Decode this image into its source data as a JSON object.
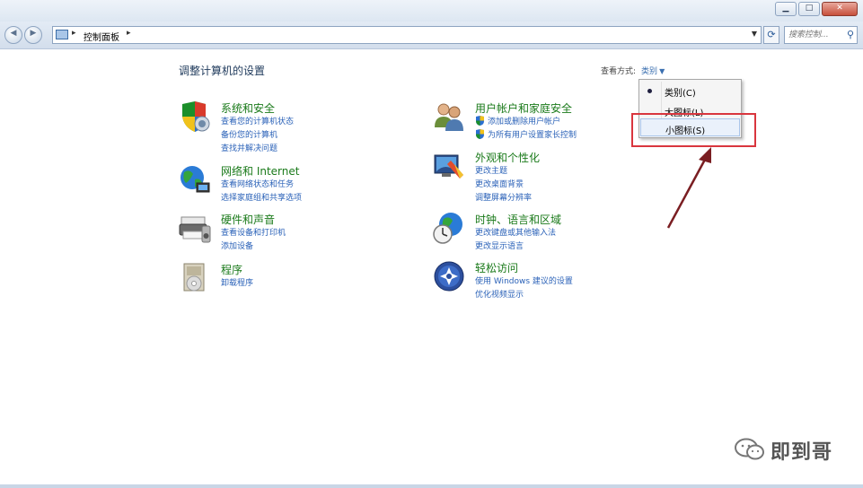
{
  "window": {
    "caption_buttons": [
      "minimize",
      "maximize",
      "close"
    ]
  },
  "navbar": {
    "address": "控制面板",
    "search_placeholder": "搜索控制..."
  },
  "content": {
    "title": "调整计算机的设置",
    "view_by_label": "查看方式:",
    "view_by_value": "类别"
  },
  "categories": [
    {
      "icon": "system-security-icon",
      "title": "系统和安全",
      "links": [
        "查看您的计算机状态",
        "备份您的计算机",
        "查找并解决问题"
      ]
    },
    {
      "icon": "network-internet-icon",
      "title": "网络和 Internet",
      "links": [
        "查看网络状态和任务",
        "选择家庭组和共享选项"
      ]
    },
    {
      "icon": "hardware-sound-icon",
      "title": "硬件和声音",
      "links": [
        "查看设备和打印机",
        "添加设备"
      ]
    },
    {
      "icon": "programs-icon",
      "title": "程序",
      "links": [
        "卸载程序"
      ]
    },
    {
      "icon": "user-accounts-icon",
      "title": "用户帐户和家庭安全",
      "links": [
        "添加或删除用户帐户",
        "为所有用户设置家长控制"
      ]
    },
    {
      "icon": "appearance-icon",
      "title": "外观和个性化",
      "links": [
        "更改主题",
        "更改桌面背景",
        "调整屏幕分辨率"
      ]
    },
    {
      "icon": "clock-region-icon",
      "title": "时钟、语言和区域",
      "links": [
        "更改键盘或其他输入法",
        "更改显示语言"
      ]
    },
    {
      "icon": "ease-of-access-icon",
      "title": "轻松访问",
      "links": [
        "使用 Windows 建议的设置",
        "优化视频显示"
      ]
    }
  ],
  "menu": {
    "items": [
      "类别(C)",
      "大图标(L)",
      "小图标(S)"
    ],
    "selected_index": 0,
    "highlighted_index": 2
  },
  "watermark": {
    "text": "即到哥"
  },
  "colors": {
    "category_title": "#1a7a1a",
    "link": "#2b62b8",
    "annotation": "#d9363e"
  }
}
